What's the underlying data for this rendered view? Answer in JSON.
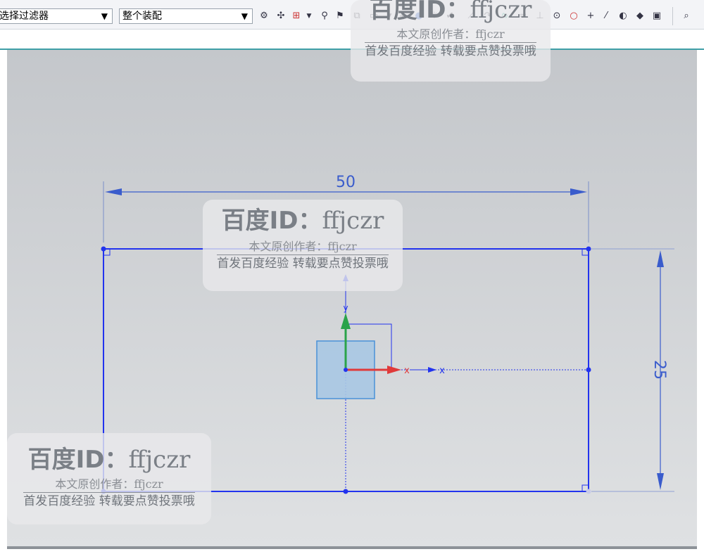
{
  "toolbar": {
    "selection_filter": "选择过滤器",
    "scope": "整个装配"
  },
  "sketch": {
    "dim_width": "50",
    "dim_height": "25",
    "axis_x": "x",
    "axis_y": "y"
  },
  "watermark": {
    "brand": "百度ID：",
    "user": "ffjczr",
    "author_line": "本文原创作者：ffjczr",
    "notice_line": "首发百度经验 转载要点赞投票哦"
  },
  "colors": {
    "sketch_line": "#2233ee",
    "dimension": "#3a5ccc",
    "x_axis": "#e03a3a",
    "y_axis": "#2aa34a",
    "datum_fill": "#a9c8e4"
  }
}
